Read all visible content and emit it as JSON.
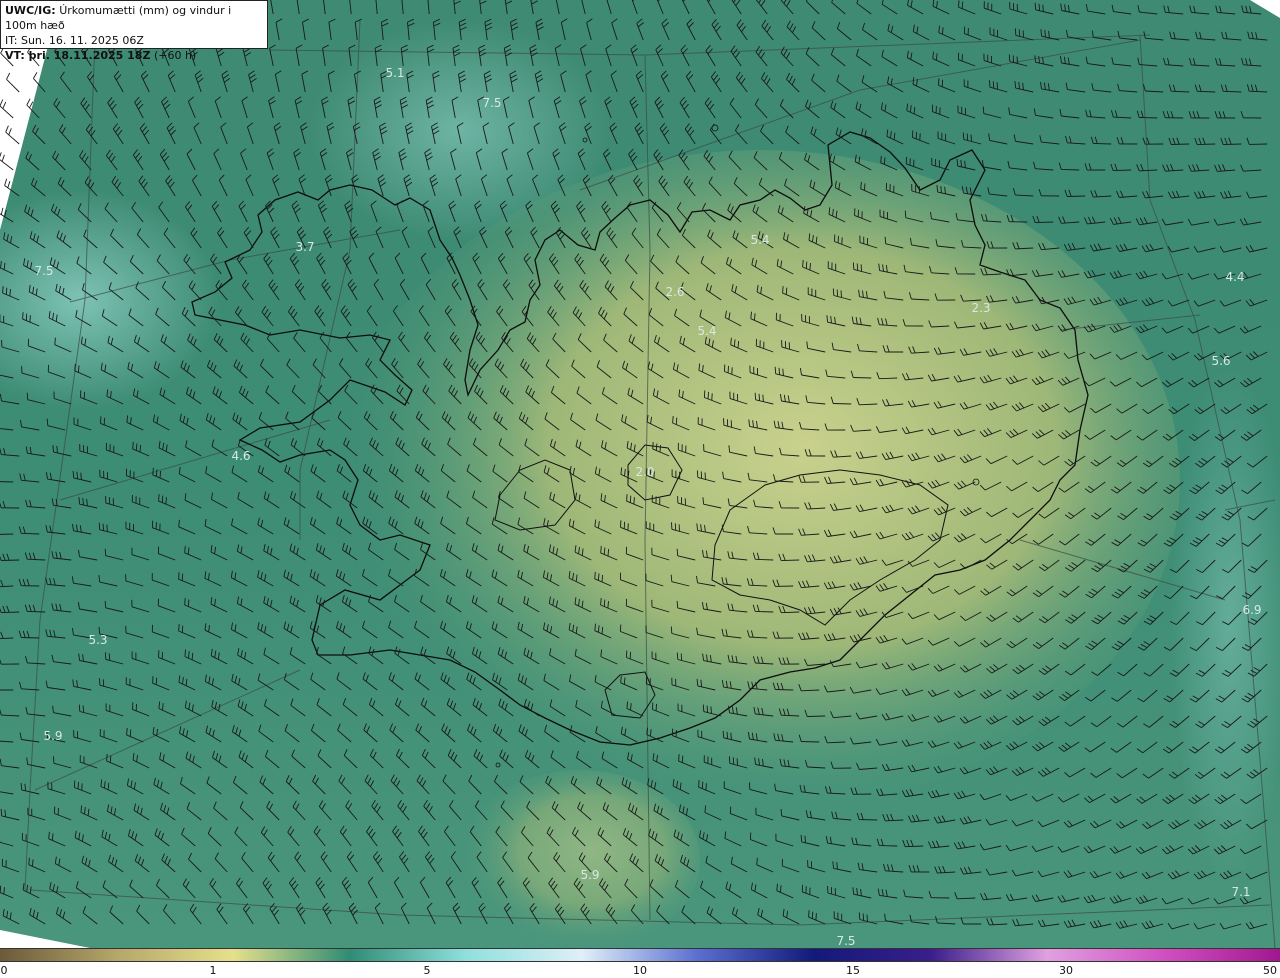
{
  "header": {
    "title_prefix": "UWC/IG:",
    "title_text": "Úrkomumætti (mm) og vindur i 100m hæð",
    "init_time": "IT: Sun. 16. 11. 2025 06Z",
    "valid_prefix": "VT: þri. 18.11.2025 18Z",
    "valid_suffix": "(+60 h)"
  },
  "field_values": [
    "5.1",
    "7.5",
    "3.7",
    "5.4",
    "2.6",
    "5.4",
    "2.3",
    "4.4",
    "5.6",
    "4.6",
    "2.0",
    "6.9",
    "5.3",
    "5.9",
    "5.9",
    "7.1",
    "7.5",
    "7.5"
  ],
  "colorbar": {
    "ticks": [
      "0",
      "1",
      "5",
      "10",
      "15",
      "30",
      "50"
    ],
    "colors": [
      "#6b5a3a",
      "#b5a66a",
      "#e6e08c",
      "#2f8c74",
      "#8fe0dc",
      "#dfeff8",
      "#5a6fd0",
      "#121a7a",
      "#3a1e8a",
      "#e0a0e0",
      "#d050c0",
      "#a01890"
    ]
  },
  "colors": {
    "ocean": "#2f7f68",
    "land_low": "#b7c478",
    "land_high": "#d6d88c",
    "coast": "#111111",
    "barb": "#1a1a1a"
  }
}
